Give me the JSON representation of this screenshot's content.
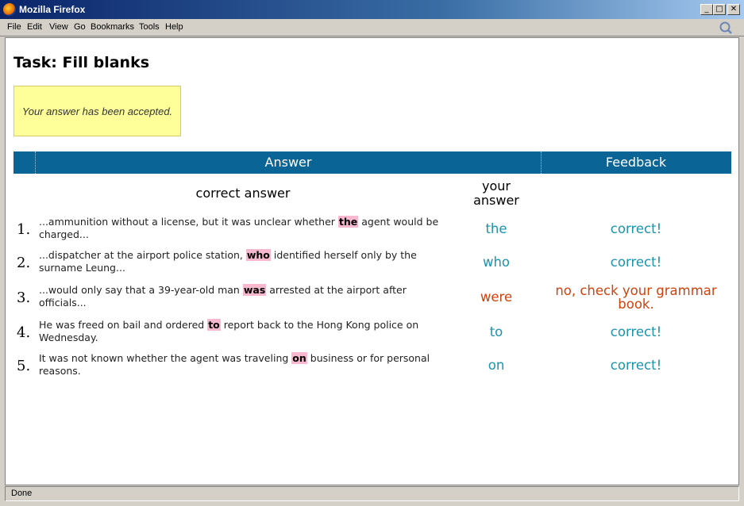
{
  "window": {
    "title": "Mozilla Firefox",
    "minimize_glyph": "_",
    "maximize_glyph": "□",
    "close_glyph": "✕"
  },
  "menu": [
    "File",
    "Edit",
    "View",
    "Go",
    "Bookmarks",
    "Tools",
    "Help"
  ],
  "page": {
    "title": "Task: Fill blanks",
    "notice": "Your answer has been accepted."
  },
  "table": {
    "headers": {
      "answer": "Answer",
      "feedback": "Feedback"
    },
    "subheaders": {
      "correct": "correct answer",
      "yours_line1": "your",
      "yours_line2": "answer"
    },
    "rows": [
      {
        "num": "1.",
        "before": "...ammunition without a license, but it was unclear whether ",
        "blank": "the",
        "after": " agent would be charged...",
        "your": "the",
        "feedback": "correct!",
        "status": "ok"
      },
      {
        "num": "2.",
        "before": "...dispatcher at the airport police station, ",
        "blank": "who",
        "after": " identified herself only by the surname Leung...",
        "your": "who",
        "feedback": "correct!",
        "status": "ok"
      },
      {
        "num": "3.",
        "before": "...would only say that a 39-year-old man ",
        "blank": "was",
        "after": " arrested at the airport after officials...",
        "your": "were",
        "feedback": "no, check your grammar book.",
        "status": "bad"
      },
      {
        "num": "4.",
        "before": "He was freed on bail and ordered ",
        "blank": "to",
        "after": " report back to the Hong Kong police on Wednesday.",
        "your": "to",
        "feedback": "correct!",
        "status": "ok"
      },
      {
        "num": "5.",
        "before": "It was not known whether the agent was traveling ",
        "blank": "on",
        "after": " business or for personal reasons.",
        "your": "on",
        "feedback": "correct!",
        "status": "ok"
      }
    ]
  },
  "status": "Done",
  "colors": {
    "header_bg": "#0b6496",
    "highlight": "#f7b8d0",
    "correct": "#1a93ad",
    "wrong": "#d2400c",
    "notice_bg": "#ffff99"
  },
  "icons": {
    "app": "firefox-icon",
    "throbber": "throbber-icon"
  }
}
